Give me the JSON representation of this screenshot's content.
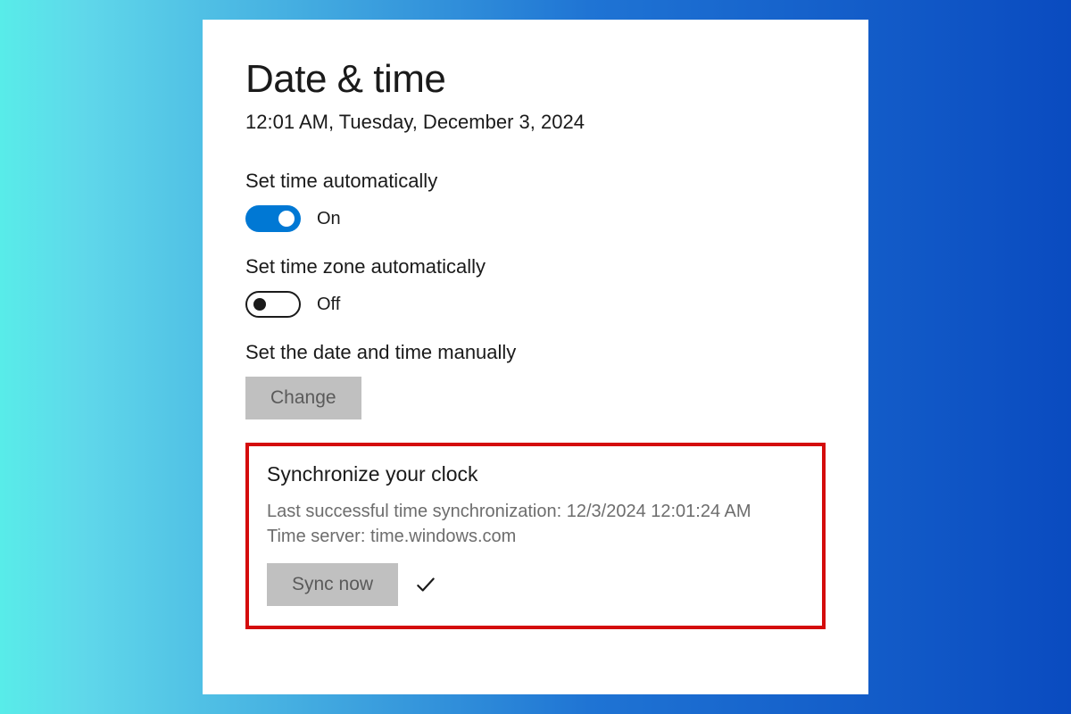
{
  "header": {
    "title": "Date & time",
    "current_time": "12:01 AM, Tuesday, December 3, 2024"
  },
  "settings": {
    "auto_time": {
      "label": "Set time automatically",
      "state": "On"
    },
    "auto_tz": {
      "label": "Set time zone automatically",
      "state": "Off"
    },
    "manual": {
      "label": "Set the date and time manually",
      "button": "Change"
    }
  },
  "sync": {
    "heading": "Synchronize your clock",
    "last_sync_label": "Last successful time synchronization:",
    "last_sync_value": "12/3/2024 12:01:24 AM",
    "server_label": "Time server:",
    "server_value": "time.windows.com",
    "button": "Sync now"
  },
  "colors": {
    "accent": "#0078d4",
    "highlight_border": "#d40c0c"
  }
}
